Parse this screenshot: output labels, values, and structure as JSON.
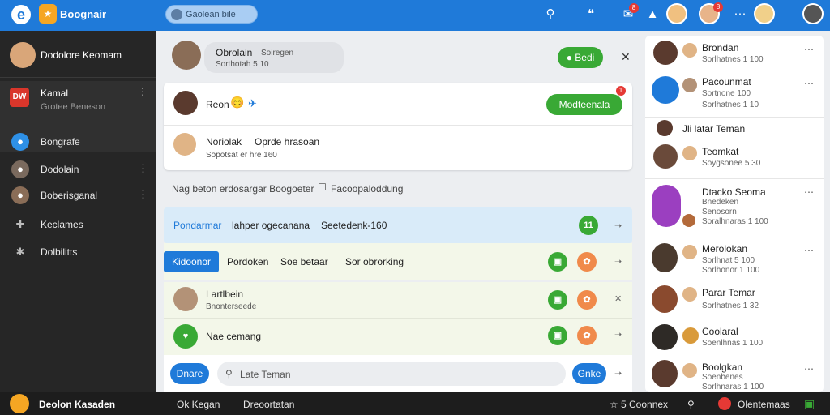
{
  "topbar": {
    "logo": "e",
    "app_name": "Boognair",
    "search_placeholder": "Gaolean bile",
    "badge1": "8",
    "badge2": "8"
  },
  "sidebar": {
    "profile_name": "Dodolore Keomam",
    "active_title": "Kamal",
    "active_sub": "Grotee Beneson",
    "active_icon": "DW",
    "items": [
      {
        "label": "Bongrafe",
        "icon": "chat-bubble-icon"
      },
      {
        "label": "Dodolain",
        "icon": "user-icon"
      },
      {
        "label": "Boberisganal",
        "icon": "user-group-icon"
      },
      {
        "label": "Keclames",
        "icon": "puzzle-icon"
      },
      {
        "label": "Dolbilitts",
        "icon": "gear-icon"
      }
    ],
    "footer_name": "Deolon Kasaden"
  },
  "main": {
    "header": {
      "name": "Obrolain",
      "sub1": "Soiregen",
      "sub2": "Sorthotah 5 10",
      "btn": "Bedi"
    },
    "card1": {
      "name": "Reon",
      "btn": "Modteenala",
      "badge": "1"
    },
    "card2": {
      "name": "Noriolak",
      "text": "Oprde hrasoan",
      "sub": "Sopotsat er hre 160"
    },
    "banner_text": "Nag beton erdosargar Boogoeter",
    "banner_link": "Facoopaloddung",
    "row1": {
      "tab1": "Pondarmar",
      "tab2": "lahper ogecanana",
      "tab3": "Seetedenk-160",
      "count": "11"
    },
    "row2": {
      "tab1": "Kidoonor",
      "tab2": "Pordoken",
      "tab3": "Soe betaar",
      "tab4": "Sor obrorking"
    },
    "row3": {
      "name": "Lartlbein",
      "sub": "Bnonterseede"
    },
    "row4": {
      "text": "Nae cemang"
    },
    "compose": {
      "left_btn": "Dnare",
      "placeholder": "Late Teman",
      "right_btn": "Gnke"
    }
  },
  "right": {
    "items": [
      {
        "name": "Brondan",
        "sub": "Sorlhatnes 1 100"
      },
      {
        "name": "Pacounmat",
        "sub": "Sortnone 100",
        "sub2": "Sorlhatnes 1 10"
      },
      {
        "name": "Jli latar Teman"
      },
      {
        "name": "Teomkat",
        "sub": "Soygsonee 5 30"
      },
      {
        "name": "Dtacko Seoma",
        "sub": "Bnedeken",
        "sub2": "Senosorn",
        "sub3": "Soralhnaras 1 100"
      },
      {
        "name": "Merolokan",
        "sub": "Sorlhnat 5 100",
        "sub2": "Sorlhonor 1 100"
      },
      {
        "name": "Parar Temar",
        "sub": "Sorlhatnes 1 32"
      },
      {
        "name": "Coolaral",
        "sub": "Soenlhnas 1 100"
      },
      {
        "name": "Boolgkan",
        "sub": "Soenbenes",
        "sub2": "Sorlhnaras 1 100"
      }
    ]
  },
  "bottombar": {
    "left1": "Ok Kegan",
    "left2": "Dreoortatan",
    "right1": "5 Coonnex",
    "right2": "Olentemaas"
  }
}
